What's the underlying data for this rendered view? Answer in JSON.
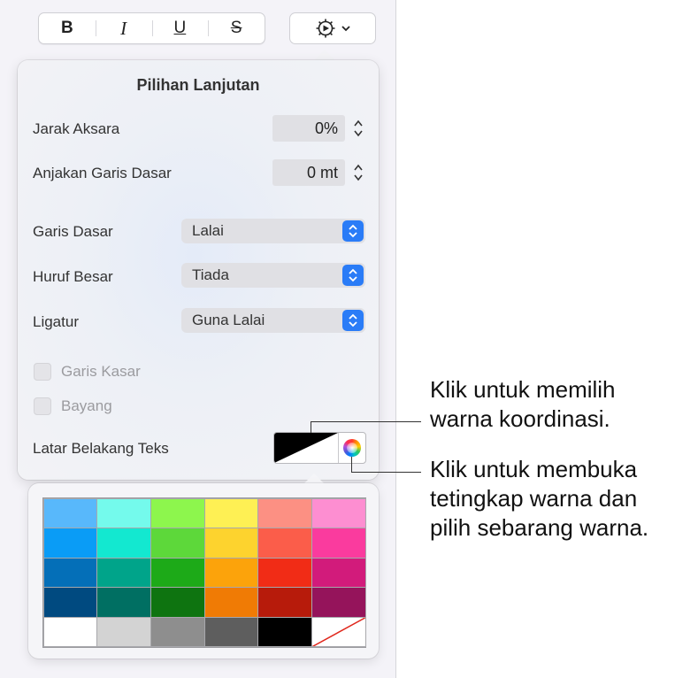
{
  "toolbar": {
    "bold_label": "B",
    "italic_label": "I",
    "underline_label": "U",
    "strikethrough_label": "S"
  },
  "popover": {
    "title": "Pilihan Lanjutan",
    "character_spacing": {
      "label": "Jarak Aksara",
      "value": "0%"
    },
    "baseline_shift": {
      "label": "Anjakan Garis Dasar",
      "value": "0 mt"
    },
    "baseline": {
      "label": "Garis Dasar",
      "value": "Lalai"
    },
    "capitalization": {
      "label": "Huruf Besar",
      "value": "Tiada"
    },
    "ligatures": {
      "label": "Ligatur",
      "value": "Guna Lalai"
    },
    "outline": {
      "label": "Garis Kasar",
      "checked": false
    },
    "shadow": {
      "label": "Bayang",
      "checked": false
    },
    "text_background": {
      "label": "Latar Belakang Teks"
    }
  },
  "palette": {
    "rows": [
      [
        "#58b8fb",
        "#74faec",
        "#8df64d",
        "#fef054",
        "#fc9083",
        "#fd8ed1"
      ],
      [
        "#0a9cf6",
        "#13e8d0",
        "#5dd83a",
        "#fdd32e",
        "#fb5d4a",
        "#fa3b9e"
      ],
      [
        "#046fb8",
        "#00a48a",
        "#1daa18",
        "#fca30b",
        "#f12c16",
        "#d21b7b"
      ],
      [
        "#004a80",
        "#006f62",
        "#0e7410",
        "#f07b05",
        "#b71b0b",
        "#95145b"
      ],
      [
        "#ffffff",
        "#d3d3d3",
        "#8e8e8e",
        "#5e5e5e",
        "#000000",
        "none"
      ]
    ]
  },
  "callouts": {
    "coordinating_color_line1": "Klik untuk memilih",
    "coordinating_color_line2": "warna koordinasi.",
    "color_window_line1": "Klik untuk membuka",
    "color_window_line2": "tetingkap warna dan",
    "color_window_line3": "pilih sebarang warna."
  }
}
